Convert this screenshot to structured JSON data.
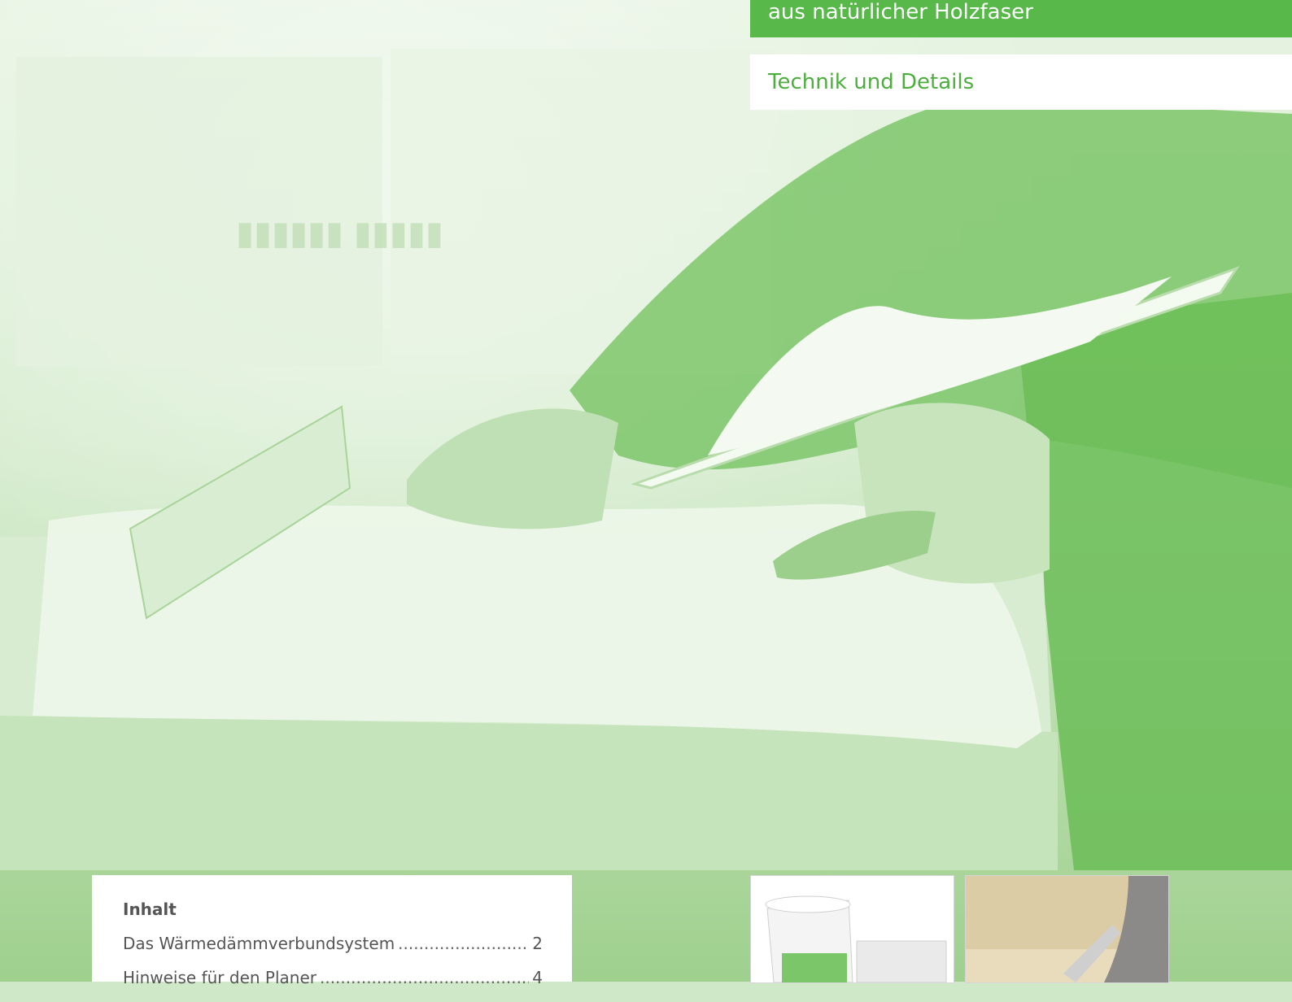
{
  "header": {
    "title_line": "aus natürlicher Holzfaser",
    "subtitle": "Technik und Details"
  },
  "toc": {
    "heading": "Inhalt",
    "items": [
      {
        "label": "Das Wärmedämmverbundsystem",
        "page": "2"
      },
      {
        "label": "Hinweise für den Planer",
        "page": "4"
      }
    ]
  },
  "colors": {
    "accent": "#58b84a",
    "subtitle_text": "#4cae3c",
    "hero_tint": "#9fd08e"
  }
}
